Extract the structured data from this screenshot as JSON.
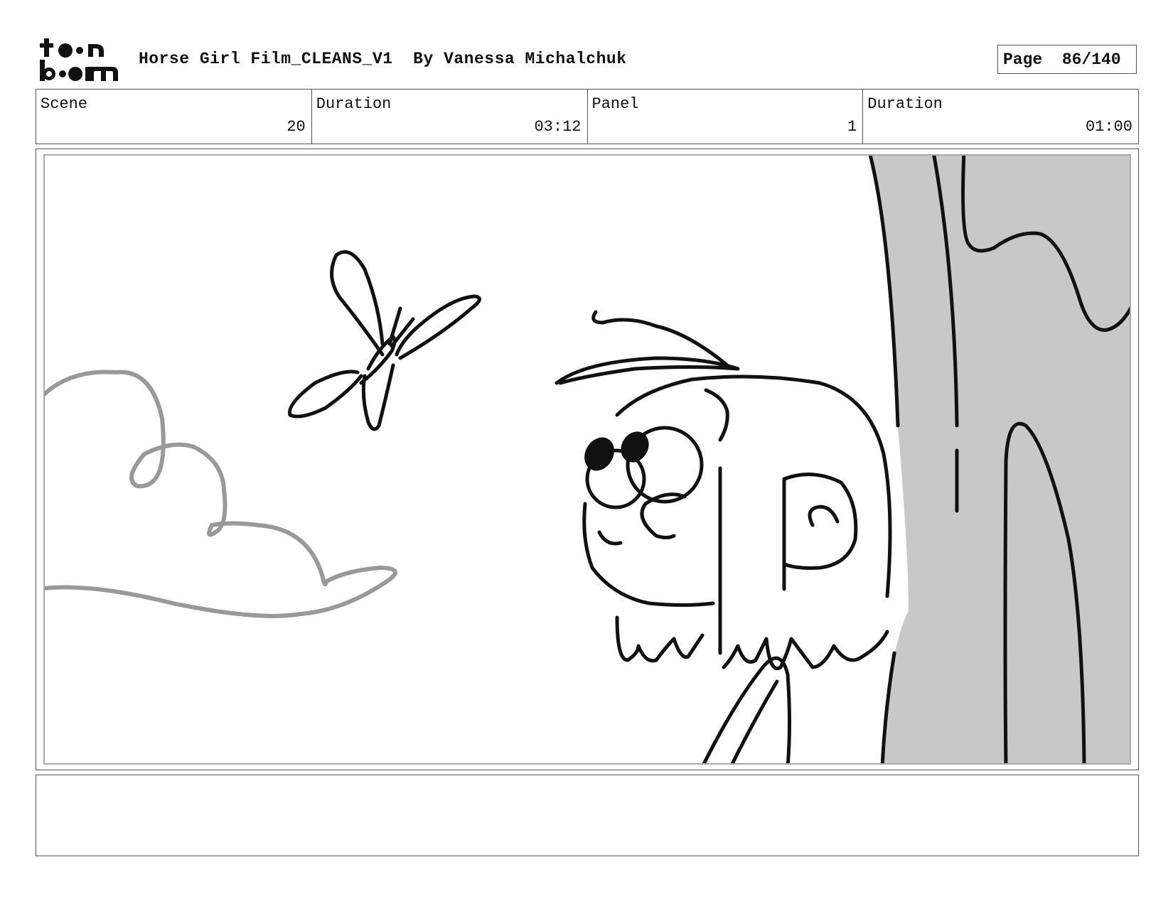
{
  "header": {
    "logo_text": "toon boom",
    "title": "Horse Girl Film_CLEANS_V1  By Vanessa Michalchuk",
    "page_label": "Page",
    "page_number": "86/140"
  },
  "info": {
    "scene_label": "Scene",
    "scene_value": "20",
    "scene_duration_label": "Duration",
    "scene_duration_value": "03:12",
    "panel_label": "Panel",
    "panel_value": "1",
    "panel_duration_label": "Duration",
    "panel_duration_value": "01:00"
  },
  "drawing": {
    "tree_fill": "#c8c8c8",
    "cloud_stroke": "#999999",
    "ink": "#111111"
  },
  "notes": {
    "text": ""
  }
}
